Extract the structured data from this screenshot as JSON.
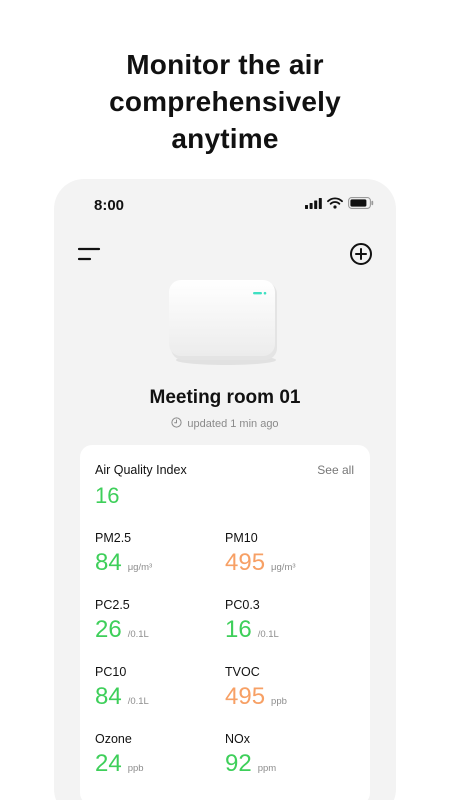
{
  "headline": {
    "line1": "Monitor the air",
    "line2": "comprehensively",
    "line3": "anytime"
  },
  "status_bar": {
    "time": "8:00",
    "icons": [
      "signal-icon",
      "wifi-icon",
      "battery-icon"
    ]
  },
  "top_bar": {
    "menu_icon": "menu-icon",
    "add_icon": "add-circle-icon"
  },
  "device": {
    "name": "Meeting room 01",
    "updated": "updated 1 min ago"
  },
  "card": {
    "aqi_label": "Air Quality Index",
    "see_all": "See all",
    "aqi_value": "16",
    "metrics": [
      {
        "label": "PM2.5",
        "value": "84",
        "unit": "μg/m³",
        "status": "good"
      },
      {
        "label": "PM10",
        "value": "495",
        "unit": "μg/m³",
        "status": "moderate"
      },
      {
        "label": "PC2.5",
        "value": "26",
        "unit": "/0.1L",
        "status": "good"
      },
      {
        "label": "PC0.3",
        "value": "16",
        "unit": "/0.1L",
        "status": "good"
      },
      {
        "label": "PC10",
        "value": "84",
        "unit": "/0.1L",
        "status": "good"
      },
      {
        "label": "TVOC",
        "value": "495",
        "unit": "ppb",
        "status": "moderate"
      },
      {
        "label": "Ozone",
        "value": "24",
        "unit": "ppb",
        "status": "good"
      },
      {
        "label": "NOx",
        "value": "92",
        "unit": "ppm",
        "status": "good"
      }
    ]
  },
  "colors": {
    "good": "#3ecf5a",
    "moderate": "#f7a065",
    "phone_bg": "#f3f3f3",
    "card_bg": "#ffffff"
  }
}
